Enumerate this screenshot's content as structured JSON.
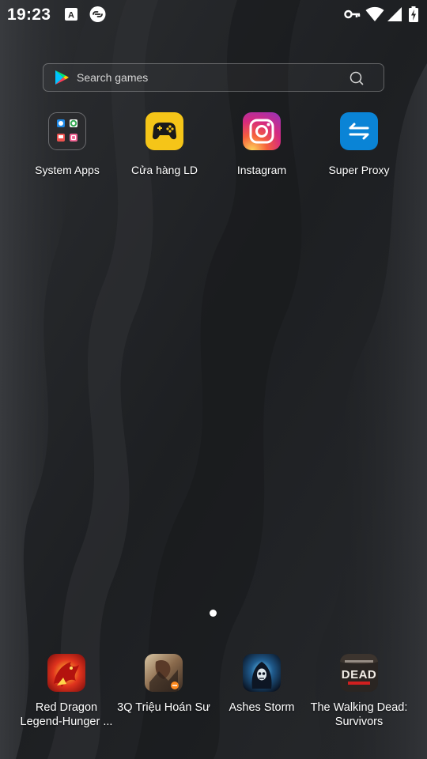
{
  "status_bar": {
    "time": "19:23",
    "left_icons": [
      "keyboard-a-icon",
      "link-icon"
    ],
    "right_icons": [
      "vpn-key-icon",
      "wifi-icon",
      "signal-icon",
      "battery-charging-icon"
    ]
  },
  "search": {
    "placeholder": "Search games",
    "leading_icon": "google-play-icon",
    "trailing_icon": "search-icon"
  },
  "apps": [
    {
      "label": "System Apps",
      "icon": "folder-icon"
    },
    {
      "label": "Cửa hàng LD",
      "icon": "ld-store-icon",
      "color": "#F5C518"
    },
    {
      "label": "Instagram",
      "icon": "instagram-icon"
    },
    {
      "label": "Super Proxy",
      "icon": "super-proxy-icon",
      "color": "#0A84D6"
    }
  ],
  "dock": [
    {
      "line1": "Red Dragon",
      "line2": "Legend-Hunger ...",
      "icon": "red-dragon-game-icon"
    },
    {
      "line1": "3Q Triệu Hoán Sư",
      "line2": "",
      "icon": "3q-trieu-hoan-su-game-icon"
    },
    {
      "line1": "Ashes Storm",
      "line2": "",
      "icon": "ashes-storm-game-icon"
    },
    {
      "line1": "The Walking Dead:",
      "line2": "Survivors",
      "icon": "walking-dead-game-icon",
      "icon_text": "DEAD"
    }
  ],
  "pagination": {
    "current_page": 1,
    "page_count": 1
  }
}
